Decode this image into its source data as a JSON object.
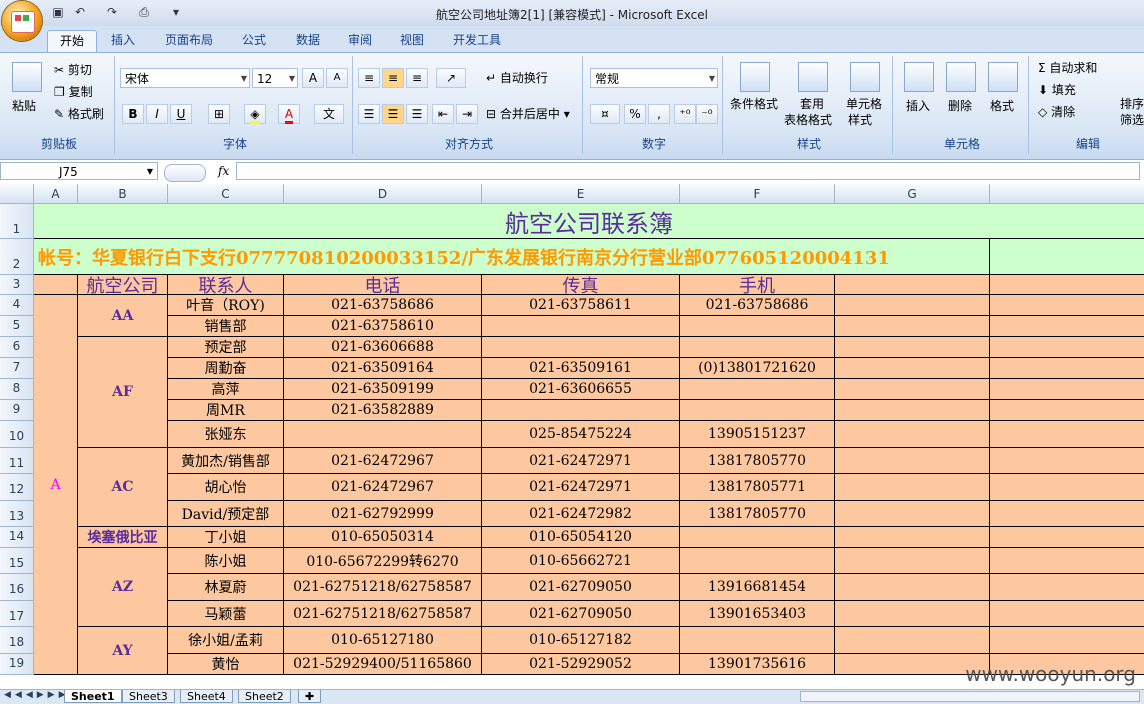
{
  "window": {
    "title": "航空公司地址簿2[1]  [兼容模式] - Microsoft Excel"
  },
  "ribbon_tabs": [
    "开始",
    "插入",
    "页面布局",
    "公式",
    "数据",
    "审阅",
    "视图",
    "开发工具"
  ],
  "ribbon": {
    "clipboard": {
      "label": "剪贴板",
      "paste": "粘贴",
      "cut": "剪切",
      "copy": "复制",
      "format_painter": "格式刷"
    },
    "font": {
      "label": "字体",
      "font_name": "宋体",
      "font_size": "12",
      "bold": "B",
      "italic": "I",
      "underline": "U",
      "grow": "A",
      "shrink": "A"
    },
    "alignment": {
      "label": "对齐方式",
      "wrap": "自动换行",
      "merge": "合并后居中"
    },
    "number": {
      "label": "数字",
      "format": "常规",
      "percent": "%",
      "comma": ","
    },
    "styles": {
      "label": "样式",
      "conditional": "条件格式",
      "table_a": "套用",
      "table_b": "表格格式",
      "cell_styles_a": "单元格",
      "cell_styles_b": "样式"
    },
    "cells": {
      "label": "单元格",
      "insert": "插入",
      "delete": "删除",
      "format": "格式"
    },
    "editing": {
      "label": "编辑",
      "autosum": "自动求和",
      "fill": "填充",
      "clear": "清除",
      "sort_a": "排序",
      "sort_b": "筛选"
    }
  },
  "formula_bar": {
    "name_box": "J75",
    "fx": "fx",
    "formula": ""
  },
  "columns": [
    "A",
    "B",
    "C",
    "D",
    "E",
    "F",
    "G"
  ],
  "rows": [
    "1",
    "2",
    "3",
    "4",
    "5",
    "6",
    "7",
    "8",
    "9",
    "10",
    "11",
    "12",
    "13",
    "14",
    "15",
    "16",
    "17",
    "18",
    "19"
  ],
  "sheet": {
    "title": "航空公司联系簿",
    "account": "帐号：华夏银行白下支行077770810200033152/广东发展银行南京分行营业部077605120004131",
    "headers": [
      "航空公司",
      "联系人",
      "电话",
      "传真",
      "手机"
    ],
    "group_letter": "A",
    "airlines": [
      "AA",
      "AF",
      "AC",
      "埃塞俄比亚",
      "AZ",
      "AY"
    ],
    "records": [
      {
        "contact": "叶音（ROY)",
        "phone": "021-63758686",
        "fax": "021-63758611",
        "mobile": "021-63758686"
      },
      {
        "contact": "销售部",
        "phone": "021-63758610",
        "fax": "",
        "mobile": ""
      },
      {
        "contact": "预定部",
        "phone": "021-63606688",
        "fax": "",
        "mobile": ""
      },
      {
        "contact": "周勤奋",
        "phone": "021-63509164",
        "fax": "021-63509161",
        "mobile": "(0)13801721620"
      },
      {
        "contact": "高萍",
        "phone": "021-63509199",
        "fax": "021-63606655",
        "mobile": ""
      },
      {
        "contact": "周MR",
        "phone": "021-63582889",
        "fax": "",
        "mobile": ""
      },
      {
        "contact": "张娅东",
        "phone": "",
        "fax": "025-85475224",
        "mobile": "13905151237"
      },
      {
        "contact": "黄加杰/销售部",
        "phone": "021-62472967",
        "fax": "021-62472971",
        "mobile": "13817805770"
      },
      {
        "contact": "胡心怡",
        "phone": "021-62472967",
        "fax": "021-62472971",
        "mobile": "13817805771"
      },
      {
        "contact": "David/预定部",
        "phone": "021-62792999",
        "fax": "021-62472982",
        "mobile": "13817805770"
      },
      {
        "contact": "丁小姐",
        "phone": "010-65050314",
        "fax": "010-65054120",
        "mobile": ""
      },
      {
        "contact": "陈小姐",
        "phone": "010-65672299转6270",
        "fax": "010-65662721",
        "mobile": ""
      },
      {
        "contact": "林夏蔚",
        "phone": "021-62751218/62758587",
        "fax": "021-62709050",
        "mobile": "13916681454"
      },
      {
        "contact": "马颖蕾",
        "phone": "021-62751218/62758587",
        "fax": "021-62709050",
        "mobile": "13901653403"
      },
      {
        "contact": "徐小姐/孟莉",
        "phone": "010-65127180",
        "fax": "010-65127182",
        "mobile": ""
      },
      {
        "contact": "黄怡",
        "phone": "021-52929400/51165860",
        "fax": "021-52929052",
        "mobile": "13901735616"
      }
    ]
  },
  "sheet_tabs": [
    "Sheet1",
    "Sheet3",
    "Sheet4",
    "Sheet2"
  ],
  "watermark": "www.wooyun.org",
  "colors": {
    "cell_fill": "#fdc89f",
    "title_fill": "#ccffcc",
    "account_text": "#ff9900",
    "header_text": "#5a2d9c",
    "group_letter": "#ff00ff"
  }
}
